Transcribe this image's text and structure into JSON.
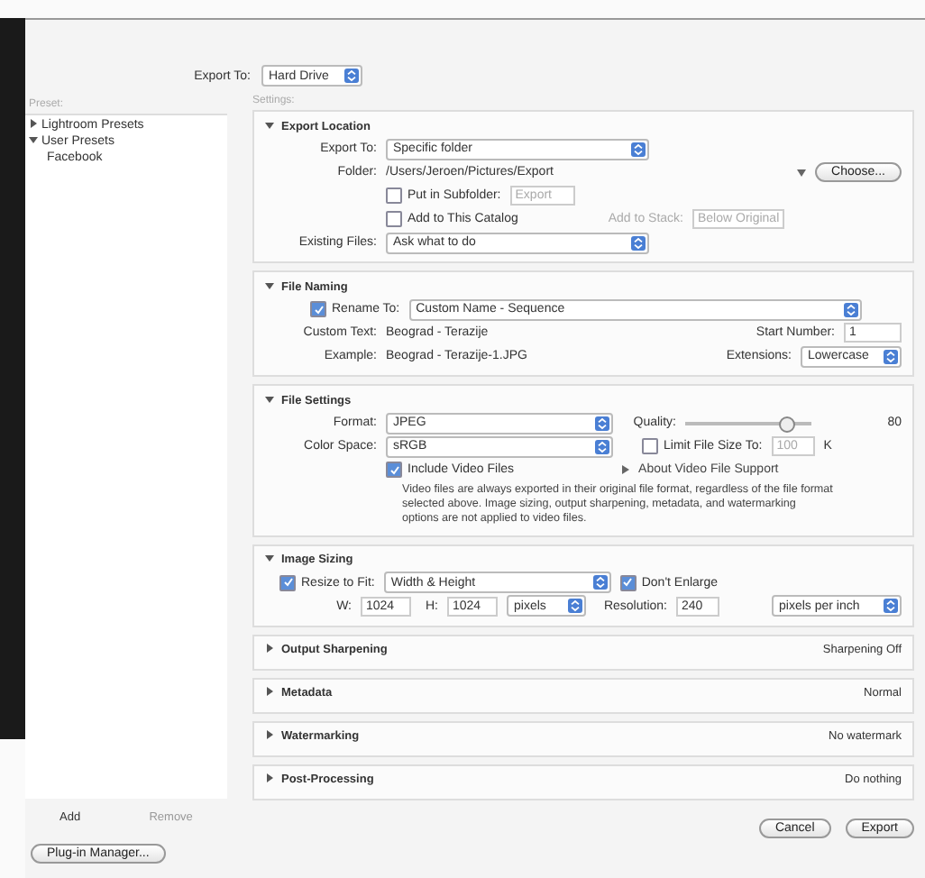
{
  "header": {
    "label": "Export To:",
    "value": "Hard Drive"
  },
  "sidebar": {
    "label": "Preset:",
    "items": [
      {
        "label": "Lightroom Presets",
        "expanded": false
      },
      {
        "label": "User Presets",
        "expanded": true,
        "children": [
          {
            "label": "Facebook"
          }
        ]
      }
    ],
    "buttons": [
      {
        "label": "Add",
        "disabled": false
      },
      {
        "label": "Remove",
        "disabled": true
      }
    ],
    "plugin_button": "Plug-in Manager..."
  },
  "settings_label": "Settings:",
  "sections": [
    {
      "kind": "export_location",
      "title": "Export Location",
      "expanded": true,
      "export_to": {
        "label": "Export To:",
        "value": "Specific folder"
      },
      "folder": {
        "label": "Folder:",
        "value": "/Users/Jeroen/Pictures/Export"
      },
      "choose_button": "Choose...",
      "subfolder": {
        "label": "Put in Subfolder:",
        "checked": false,
        "value": "Export"
      },
      "add_to_catalog": {
        "label": "Add to This Catalog",
        "checked": false
      },
      "add_to_stack": {
        "label": "Add to Stack:",
        "value": "Below Original",
        "disabled": true
      },
      "existing_files": {
        "label": "Existing Files:",
        "value": "Ask what to do"
      }
    },
    {
      "kind": "file_naming",
      "title": "File Naming",
      "expanded": true,
      "rename": {
        "label": "Rename To:",
        "checked": true,
        "value": "Custom Name - Sequence"
      },
      "custom_text": {
        "label": "Custom Text:",
        "value": "Beograd - Terazije"
      },
      "start_number": {
        "label": "Start Number:",
        "value": "1"
      },
      "example": {
        "label": "Example:",
        "value": "Beograd - Terazije-1.JPG"
      },
      "extensions": {
        "label": "Extensions:",
        "value": "Lowercase"
      }
    },
    {
      "kind": "file_settings",
      "title": "File Settings",
      "expanded": true,
      "format": {
        "label": "Format:",
        "value": "JPEG"
      },
      "quality": {
        "label": "Quality:",
        "level": 0.8,
        "reading": "80"
      },
      "color_space": {
        "label": "Color Space:",
        "value": "sRGB"
      },
      "limit_size": {
        "label": "Limit File Size To:",
        "checked": false,
        "value": "100",
        "unit": "K"
      },
      "video": {
        "label": "Include Video Files",
        "checked": true
      },
      "video_link": "About Video File Support",
      "video_note": "Video files are always exported in their original file format, regardless of the file format selected above. Image sizing, output sharpening, metadata, and watermarking options are not applied to video files."
    },
    {
      "kind": "image_sizing",
      "title": "Image Sizing",
      "expanded": true,
      "resize": {
        "label": "Resize to Fit:",
        "checked": true,
        "value": "Width & Height"
      },
      "dont_enlarge": {
        "label": "Don't Enlarge",
        "checked": true
      },
      "width": {
        "label": "W:",
        "value": "1024"
      },
      "height": {
        "label": "H:",
        "value": "1024"
      },
      "unit": "pixels",
      "resolution": {
        "label": "Resolution:",
        "value": "240",
        "unit": "pixels per inch"
      }
    },
    {
      "kind": "collapsed",
      "title": "Output Sharpening",
      "expanded": false,
      "summary": "Sharpening Off"
    },
    {
      "kind": "collapsed",
      "title": "Metadata",
      "expanded": false,
      "summary": "Normal"
    },
    {
      "kind": "collapsed",
      "title": "Watermarking",
      "expanded": false,
      "summary": "No watermark"
    },
    {
      "kind": "collapsed",
      "title": "Post-Processing",
      "expanded": false,
      "summary": "Do nothing"
    }
  ],
  "footer": {
    "buttons": [
      {
        "label": "Cancel"
      },
      {
        "label": "Export"
      }
    ]
  }
}
